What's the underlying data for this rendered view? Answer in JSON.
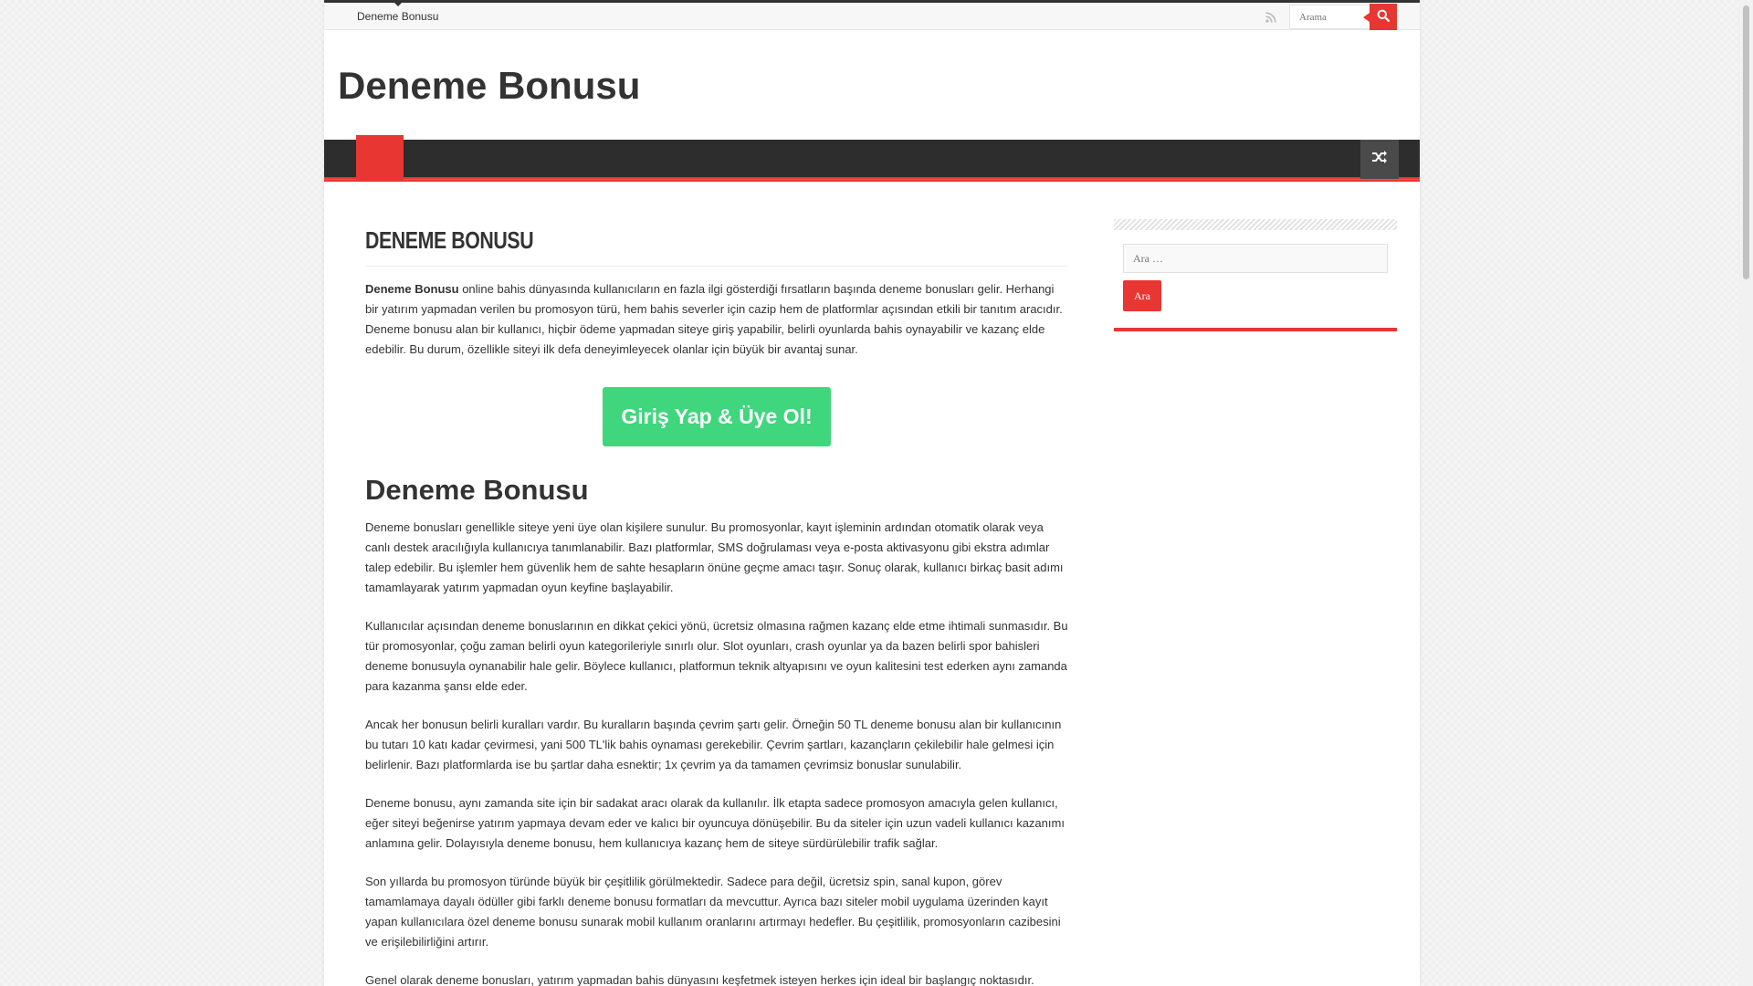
{
  "top_nav": {
    "menu_item": "Deneme Bonusu",
    "search_placeholder": "Arama"
  },
  "header": {
    "site_title": "Deneme Bonusu"
  },
  "post": {
    "title": "Deneme Bonusu",
    "intro_bold": "Deneme Bonusu",
    "intro_rest": " online bahis dünyasında kullanıcıların en fazla ilgi gösterdiği fırsatların başında deneme bonusları gelir. Herhangi bir yatırım yapmadan verilen bu promosyon türü, hem bahis severler için cazip hem de platformlar açısından etkili bir tanıtım aracıdır. Deneme bonusu alan bir kullanıcı, hiçbir ödeme yapmadan siteye giriş yapabilir, belirli oyunlarda bahis oynayabilir ve kazanç elde edebilir. Bu durum, özellikle siteyi ilk defa deneyimleyecek olanlar için büyük bir avantaj sunar.",
    "cta": "Giriş Yap & Üye Ol!",
    "heading": "Deneme Bonusu",
    "paragraphs": [
      "Deneme bonusları genellikle siteye yeni üye olan kişilere sunulur. Bu promosyonlar, kayıt işleminin ardından otomatik olarak veya canlı destek aracılığıyla kullanıcıya tanımlanabilir. Bazı platformlar, SMS doğrulaması veya e-posta aktivasyonu gibi ekstra adımlar talep edebilir. Bu işlemler hem güvenlik hem de sahte hesapların önüne geçme amacı taşır. Sonuç olarak, kullanıcı birkaç basit adımı tamamlayarak yatırım yapmadan oyun keyfine başlayabilir.",
      "Kullanıcılar açısından deneme bonuslarının en dikkat çekici yönü, ücretsiz olmasına rağmen kazanç elde etme ihtimali sunmasıdır. Bu tür promosyonlar, çoğu zaman belirli oyun kategorileriyle sınırlı olur. Slot oyunları, crash oyunlar ya da bazen belirli spor bahisleri deneme bonusuyla oynanabilir hale gelir. Böylece kullanıcı, platformun teknik altyapısını ve oyun kalitesini test ederken aynı zamanda para kazanma şansı elde eder.",
      "Ancak her bonusun belirli kuralları vardır. Bu kuralların başında çevrim şartı gelir. Örneğin 50 TL deneme bonusu alan bir kullanıcının bu tutarı 10 katı kadar çevirmesi, yani 500 TL'lik bahis oynaması gerekebilir. Çevrim şartları, kazançların çekilebilir hale gelmesi için belirlenir. Bazı platformlarda ise bu şartlar daha esnektir; 1x çevrim ya da tamamen çevrimsiz bonuslar sunulabilir.",
      "Deneme bonusu, aynı zamanda site için bir sadakat aracı olarak da kullanılır. İlk etapta sadece promosyon amacıyla gelen kullanıcı, eğer siteyi beğenirse yatırım yapmaya devam eder ve kalıcı bir oyuncuya dönüşebilir. Bu da siteler için uzun vadeli kullanıcı kazanımı anlamına gelir. Dolayısıyla deneme bonusu, hem kullanıcıya kazanç hem de siteye sürdürülebilir trafik sağlar.",
      "Son yıllarda bu promosyon türünde büyük bir çeşitlilik görülmektedir. Sadece para değil, ücretsiz spin, sanal kupon, görev tamamlamaya dayalı ödüller gibi farklı deneme bonusu formatları da mevcuttur. Ayrıca bazı siteler mobil uygulama üzerinden kayıt yapan kullanıcılara özel deneme bonusu sunarak mobil kullanım oranlarını artırmayı hedefler. Bu çeşitlilik, promosyonların cazibesini ve erişilebilirliğini artırır.",
      "Genel olarak deneme bonusları, yatırım yapmadan bahis dünyasını keşfetmek isteyen herkes için ideal bir başlangıç noktasıdır."
    ]
  },
  "sidebar": {
    "search_placeholder": "Ara …",
    "search_button": "Ara"
  },
  "colors": {
    "accent": "#e83632",
    "nav_bg": "#2d2d2d",
    "cta": "#3fd67e"
  },
  "icons": [
    "rss-icon",
    "search-icon",
    "random-article-icon"
  ]
}
